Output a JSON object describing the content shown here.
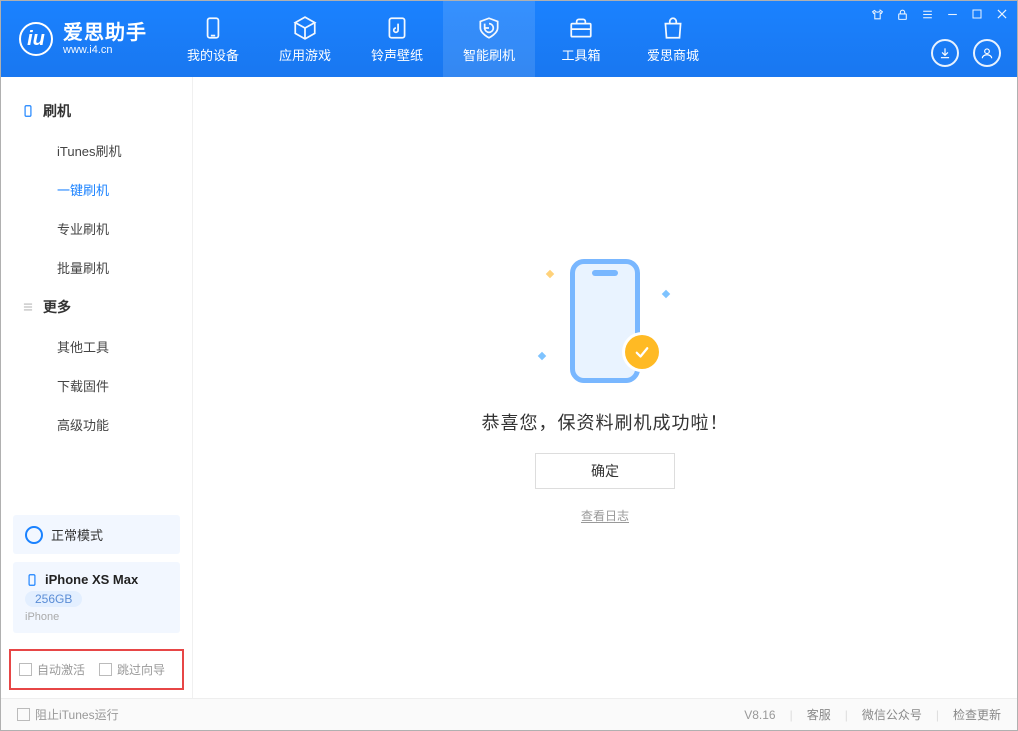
{
  "logo": {
    "badge": "iu",
    "title": "爱思助手",
    "subtitle": "www.i4.cn"
  },
  "nav": {
    "items": [
      {
        "label": "我的设备"
      },
      {
        "label": "应用游戏"
      },
      {
        "label": "铃声壁纸"
      },
      {
        "label": "智能刷机"
      },
      {
        "label": "工具箱"
      },
      {
        "label": "爱思商城"
      }
    ]
  },
  "sidebar": {
    "group1": {
      "title": "刷机",
      "items": [
        "iTunes刷机",
        "一键刷机",
        "专业刷机",
        "批量刷机"
      ]
    },
    "group2": {
      "title": "更多",
      "items": [
        "其他工具",
        "下载固件",
        "高级功能"
      ]
    },
    "mode_box": "正常模式",
    "device": {
      "name": "iPhone XS Max",
      "storage": "256GB",
      "type": "iPhone"
    },
    "checks": {
      "auto_activate": "自动激活",
      "skip_guide": "跳过向导"
    }
  },
  "main": {
    "success_text": "恭喜您，保资料刷机成功啦！",
    "ok_label": "确定",
    "log_link": "查看日志"
  },
  "statusbar": {
    "block_itunes": "阻止iTunes运行",
    "version": "V8.16",
    "links": [
      "客服",
      "微信公众号",
      "检查更新"
    ]
  }
}
